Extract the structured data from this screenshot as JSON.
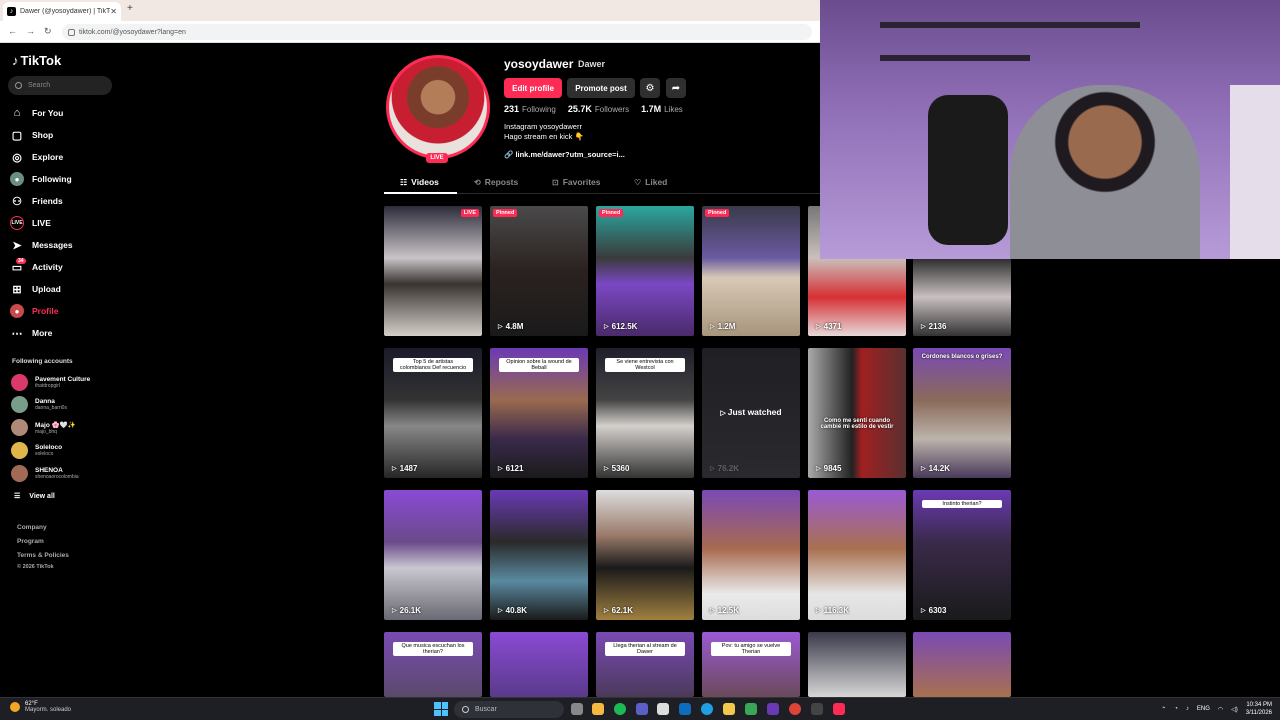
{
  "browser": {
    "tab_title": "Dawer (@yosoydawer) | TikTok",
    "url": "tiktok.com/@yosoydawer?lang=en"
  },
  "sidebar": {
    "logo": "TikTok",
    "search_placeholder": "Search",
    "nav": [
      {
        "label": "For You",
        "icon": "home-icon"
      },
      {
        "label": "Shop",
        "icon": "shop-icon"
      },
      {
        "label": "Explore",
        "icon": "compass-icon"
      },
      {
        "label": "Following",
        "icon": "following-icon"
      },
      {
        "label": "Friends",
        "icon": "friends-icon"
      },
      {
        "label": "LIVE",
        "icon": "live-icon"
      },
      {
        "label": "Messages",
        "icon": "messages-icon"
      },
      {
        "label": "Activity",
        "icon": "activity-icon",
        "badge": "34"
      },
      {
        "label": "Upload",
        "icon": "upload-icon"
      },
      {
        "label": "Profile",
        "icon": "profile-icon"
      },
      {
        "label": "More",
        "icon": "more-icon"
      }
    ],
    "following_title": "Following accounts",
    "accounts": [
      {
        "name": "Pavement Culture",
        "handle": "thatdropgirl",
        "color": "#d93a6a"
      },
      {
        "name": "Danna",
        "handle": "danna_barri0s",
        "color": "#7a9c8a"
      },
      {
        "name": "Majo 🌸🤍✨",
        "handle": "majo_bhq",
        "color": "#b08a78"
      },
      {
        "name": "Soleloco",
        "handle": "soleloco",
        "color": "#e0b64a"
      },
      {
        "name": "SHENOA",
        "handle": "shenoaorocolombia",
        "color": "#a06a55"
      }
    ],
    "view_all": "View all",
    "footer": [
      "Company",
      "Program",
      "Terms & Policies",
      "© 2026 TikTok"
    ]
  },
  "profile": {
    "username": "yosoydawer",
    "nickname": "Dawer",
    "live_badge": "LIVE",
    "edit_button": "Edit profile",
    "promote_button": "Promote post",
    "following_count": "231",
    "following_label": "Following",
    "followers_count": "25.7K",
    "followers_label": "Followers",
    "likes_count": "1.7M",
    "likes_label": "Likes",
    "bio_line1": "Instagram yosoydawerr",
    "bio_line2": "Hago stream en kick 👇",
    "link": "link.me/dawer?utm_source=i..."
  },
  "tabs": [
    "Videos",
    "Reposts",
    "Favorites",
    "Liked"
  ],
  "videos": [
    {
      "views": "",
      "badge": "LIVE",
      "bg": "linear-gradient(180deg,#2c2c3a 0%,#c9c4c8 40%,#3a3430 60%,#d4cfc9 100%)"
    },
    {
      "views": "4.8M",
      "badge": "Pinned",
      "bg": "linear-gradient(180deg,#4a4a4a 0%,#2b2220 50%,#1a1a1a 100%)"
    },
    {
      "views": "612.5K",
      "badge": "Pinned",
      "bg": "linear-gradient(180deg,#2aa7a0 0%,#3a3a3a 40%,#7a48c4 60%,#4a2a6a 100%)"
    },
    {
      "views": "1.2M",
      "badge": "Pinned",
      "bg": "linear-gradient(180deg,#3a3a4a 0%,#6a5aa0 40%,#d8c9b6 55%,#a8957d 100%)"
    },
    {
      "views": "4371",
      "badge": "",
      "bg": "linear-gradient(180deg,#777 0%,#c9c0bb 40%,#d63034 70%,#e6d9d9 100%)"
    },
    {
      "views": "2136",
      "badge": "",
      "bg": "linear-gradient(180deg,#5a5a5a 0%,#2b2b2b 40%,#c9c0c0 70%,#333 100%)"
    },
    {
      "views": "1487",
      "badge": "",
      "caption": "Top 5 de artistas colombianos Def recuencio",
      "bg": "linear-gradient(180deg,#1a1a2a 0%,#333 40%,#888 60%,#262626 100%)"
    },
    {
      "views": "6121",
      "badge": "",
      "caption": "Opinion sobre la wound de Beball",
      "bg": "linear-gradient(180deg,#6a3ab4 0%,#9a6a4f 40%,#3a2a4a 70%,#1a1a1a 100%)"
    },
    {
      "views": "5360",
      "badge": "",
      "caption": "Se viene entrevista con Westcol",
      "bg": "linear-gradient(180deg,#1f1f2a 0%,#444 40%,#d4d0cc 60%,#333 100%)"
    },
    {
      "views": "76.2K",
      "badge": "",
      "just_watched": "Just watched",
      "bg": "linear-gradient(180deg,#1f1f24 0%,#2a2a2e 100%)"
    },
    {
      "views": "9845",
      "badge": "",
      "caption_plain": "Como me sentí cuando cambié mi estilo de vestir",
      "bg": "linear-gradient(90deg,#aaa 0%,#222 45%,#a02020 55%,#5a3030 100%)"
    },
    {
      "views": "14.2K",
      "badge": "",
      "caption_plain": "Cordones blancos o grises?",
      "bg": "linear-gradient(180deg,#7a4ab4 0%,#8a6a5a 40%,#bcb4ac 70%,#4a3a5a 100%)"
    },
    {
      "views": "26.1K",
      "badge": "",
      "bg": "linear-gradient(180deg,#8a4ad4 0%,#6a4a8a 40%,#c9c7cf 60%,#6a6a74 100%)"
    },
    {
      "views": "40.8K",
      "badge": "",
      "bg": "linear-gradient(180deg,#6a3ab4 0%,#2a2a2a 40%,#5a8aa0 70%,#1a1a1a 100%)"
    },
    {
      "views": "62.1K",
      "badge": "",
      "bg": "linear-gradient(180deg,#ddd 0%,#9a7a6a 35%,#1a1a1a 60%,#a08040 100%)"
    },
    {
      "views": "12.5K",
      "badge": "",
      "bg": "linear-gradient(180deg,#7a4ab4 0%,#a86a50 45%,#eaeaea 80%,#ddd 100%)"
    },
    {
      "views": "116.3K",
      "badge": "",
      "bg": "linear-gradient(180deg,#9a5ad4 0%,#a8704f 45%,#e6e6e6 80%,#ddd 100%)"
    },
    {
      "views": "6303",
      "badge": "",
      "caption": "Instinto therian?",
      "bg": "linear-gradient(180deg,#6a3ab4 0%,#3a2a4a 40%,#1a1a1a 100%)"
    },
    {
      "views": "",
      "badge": "",
      "caption": "Que musica escuchan los therian?",
      "bg": "linear-gradient(180deg,#7a4ab4 0%,#5a4a6a 100%)"
    },
    {
      "views": "",
      "badge": "",
      "bg": "linear-gradient(180deg,#8a4ad4 0%,#5a3a8a 100%)"
    },
    {
      "views": "",
      "badge": "",
      "caption": "Llega therian al stream de Dawer",
      "bg": "linear-gradient(180deg,#7a4ab4 0%,#4a3a5a 100%)"
    },
    {
      "views": "",
      "badge": "",
      "caption": "Pov: tu amigo se vuelve Therian",
      "bg": "linear-gradient(180deg,#9a5ad4 0%,#6a4a5a 100%)"
    },
    {
      "views": "",
      "badge": "",
      "bg": "linear-gradient(180deg,#3a3a4a 0%,#d6d6d6 100%)"
    },
    {
      "views": "",
      "badge": "",
      "bg": "linear-gradient(180deg,#7a4ab4 0%,#a8704f 100%)"
    }
  ],
  "taskbar": {
    "temp": "62°F",
    "weather": "Mayorm. soleado",
    "search": "Buscar",
    "lang": "ENG",
    "time": "10:34 PM",
    "date": "3/11/2026"
  }
}
